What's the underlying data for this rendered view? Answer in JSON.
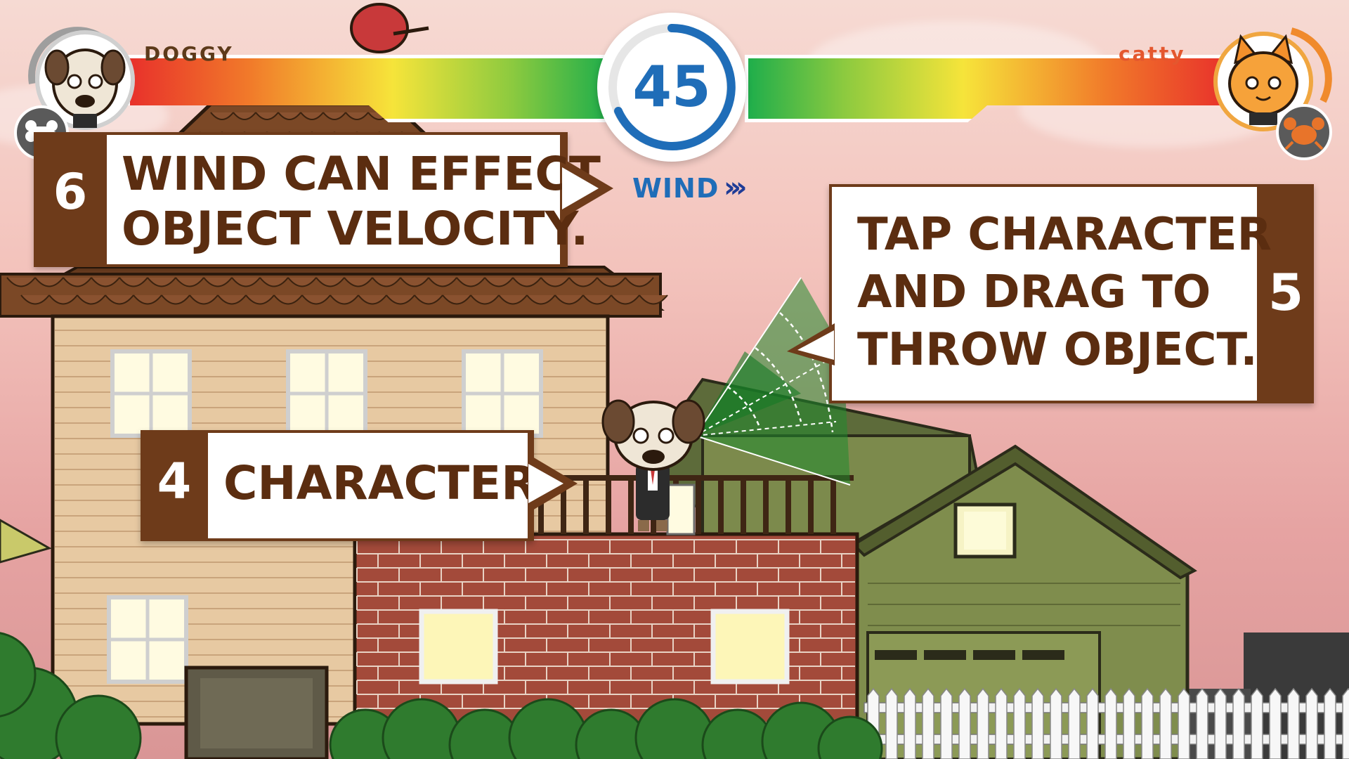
{
  "players": {
    "left": {
      "name": "DOGGY",
      "health": 1.0,
      "item_icon": "bone-icon"
    },
    "right": {
      "name": "catty",
      "health": 1.0,
      "item_icon": "crab-icon"
    }
  },
  "timer": {
    "value": "45"
  },
  "wind": {
    "label": "WIND",
    "arrows": "›››",
    "direction": "right"
  },
  "tutorial": [
    {
      "step": "6",
      "text_line1": "WIND CAN EFFECT",
      "text_line2": "OBJECT VELOCITY."
    },
    {
      "step": "5",
      "text_line1": "TAP CHARACTER",
      "text_line2": "AND DRAG TO",
      "text_line3": "THROW OBJECT."
    },
    {
      "step": "4",
      "text_line1": "CHARACTER."
    }
  ],
  "colors": {
    "callout_brown": "#6e3b1a",
    "timer_blue": "#1f6db8",
    "catty_orange": "#e4572e"
  }
}
